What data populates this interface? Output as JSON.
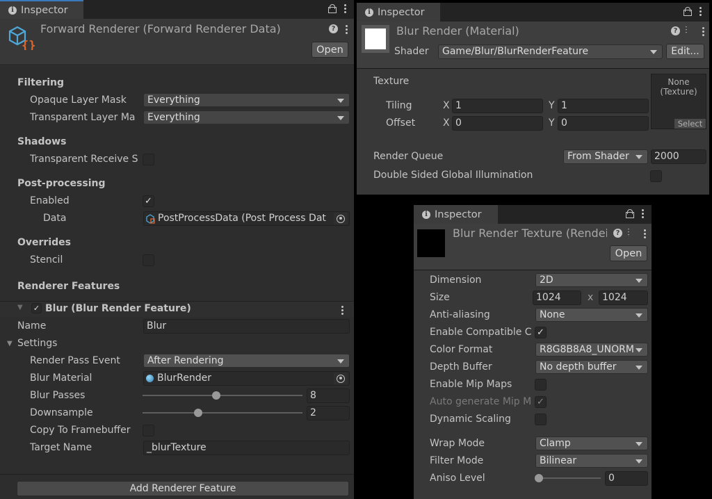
{
  "left": {
    "tab": "Inspector",
    "title": "Forward Renderer (Forward Renderer Data)",
    "open_label": "Open",
    "sections": {
      "filtering": "Filtering",
      "shadows": "Shadows",
      "post_processing": "Post-processing",
      "overrides": "Overrides",
      "renderer_features": "Renderer Features"
    },
    "opaque_layer_mask": {
      "label": "Opaque Layer Mask",
      "value": "Everything"
    },
    "transparent_layer_mask": {
      "label": "Transparent Layer Ma",
      "value": "Everything"
    },
    "transparent_receive_shadows": {
      "label": "Transparent Receive S",
      "checked": false
    },
    "pp_enabled": {
      "label": "Enabled",
      "checked": true
    },
    "pp_data": {
      "label": "Data",
      "value": "PostProcessData (Post Process Dat"
    },
    "stencil": {
      "label": "Stencil",
      "checked": false
    },
    "feature": {
      "title": "Blur (Blur Render Feature)",
      "enabled": true,
      "name": {
        "label": "Name",
        "value": "Blur"
      },
      "settings_label": "Settings",
      "render_pass_event": {
        "label": "Render Pass Event",
        "value": "After Rendering"
      },
      "blur_material": {
        "label": "Blur Material",
        "value": "BlurRender"
      },
      "blur_passes": {
        "label": "Blur Passes",
        "value": "8",
        "fraction": 0.46
      },
      "downsample": {
        "label": "Downsample",
        "value": "2",
        "fraction": 0.34
      },
      "copy_to_framebuffer": {
        "label": "Copy To Framebuffer",
        "checked": false
      },
      "target_name": {
        "label": "Target Name",
        "value": "_blurTexture"
      }
    },
    "add_feature_label": "Add Renderer Feature"
  },
  "material": {
    "tab": "Inspector",
    "title": "Blur Render (Material)",
    "shader_label": "Shader",
    "shader_value": "Game/Blur/BlurRenderFeature",
    "edit_label": "Edit...",
    "texture_label": "Texture",
    "tiling": {
      "label": "Tiling",
      "x": "1",
      "y": "1"
    },
    "offset": {
      "label": "Offset",
      "x": "0",
      "y": "0"
    },
    "axis_x": "X",
    "axis_y": "Y",
    "texture_slot": {
      "line1": "None",
      "line2": "(Texture)",
      "select": "Select"
    },
    "render_queue": {
      "label": "Render Queue",
      "mode": "From Shader",
      "value": "2000"
    },
    "double_sided_gi": {
      "label": "Double Sided Global Illumination",
      "checked": false
    }
  },
  "rt": {
    "tab": "Inspector",
    "title": "Blur Render Texture (Rendei",
    "open_label": "Open",
    "dimension": {
      "label": "Dimension",
      "value": "2D"
    },
    "size": {
      "label": "Size",
      "w": "1024",
      "sep": "x",
      "h": "1024"
    },
    "anti_aliasing": {
      "label": "Anti-aliasing",
      "value": "None"
    },
    "enable_compatible": {
      "label": "Enable Compatible C",
      "checked": true
    },
    "color_format": {
      "label": "Color Format",
      "value": "R8G8B8A8_UNORM"
    },
    "depth_buffer": {
      "label": "Depth Buffer",
      "value": "No depth buffer"
    },
    "enable_mip_maps": {
      "label": "Enable Mip Maps",
      "checked": false
    },
    "auto_generate_mip": {
      "label": "Auto generate Mip M",
      "checked": true
    },
    "dynamic_scaling": {
      "label": "Dynamic Scaling",
      "checked": false
    },
    "wrap_mode": {
      "label": "Wrap Mode",
      "value": "Clamp"
    },
    "filter_mode": {
      "label": "Filter Mode",
      "value": "Bilinear"
    },
    "aniso_level": {
      "label": "Aniso Level",
      "value": "0",
      "fraction": 0
    }
  },
  "glyphs": {
    "check": "✓",
    "info": "i",
    "help": "?",
    "triangle_down": "▼"
  },
  "colors": {
    "panel_bg": "#383838",
    "tab_bg": "#3c3c3c",
    "field_bg": "#2a2a2a",
    "dropdown_bg": "#515151",
    "icon_blue": "#4fa8d8",
    "icon_orange": "#e0662a"
  }
}
